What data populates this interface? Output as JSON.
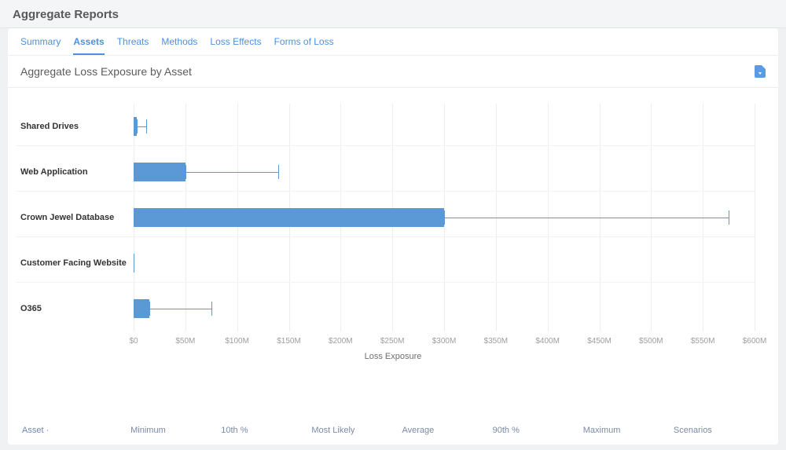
{
  "page_title": "Aggregate Reports",
  "tabs": [
    "Summary",
    "Assets",
    "Threats",
    "Methods",
    "Loss Effects",
    "Forms of Loss"
  ],
  "active_tab_index": 1,
  "chart_title": "Aggregate Loss Exposure by Asset",
  "xlabel": "Loss Exposure",
  "chart_data": {
    "type": "bar",
    "xlabel": "Loss Exposure",
    "xlim": [
      0,
      600
    ],
    "x_unit": "$M",
    "x_ticks": [
      "$0",
      "$50M",
      "$100M",
      "$150M",
      "$200M",
      "$250M",
      "$300M",
      "$350M",
      "$400M",
      "$450M",
      "$500M",
      "$550M",
      "$600M"
    ],
    "categories": [
      "Shared Drives",
      "Web Application",
      "Crown Jewel Database",
      "Customer Facing Website",
      "O365"
    ],
    "series": [
      {
        "name": "bar_end",
        "values": [
          3,
          50,
          300,
          1,
          15
        ]
      },
      {
        "name": "whisker_low",
        "values": [
          3,
          50,
          300,
          1,
          15
        ]
      },
      {
        "name": "whisker_high",
        "values": [
          12,
          140,
          575,
          1,
          75
        ]
      }
    ]
  },
  "table_columns": [
    "Asset ·",
    "Minimum",
    "10th %",
    "Most Likely",
    "Average",
    "90th %",
    "Maximum",
    "Scenarios"
  ]
}
